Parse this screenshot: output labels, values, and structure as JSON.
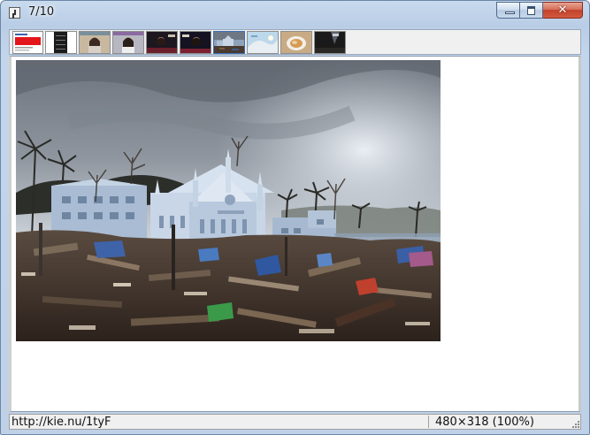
{
  "window": {
    "title": "7/10"
  },
  "title_controls": {
    "close_glyph": "✕"
  },
  "icons": {
    "app": "image-viewer-icon",
    "minimize": "minimize-icon",
    "maximize": "maximize-icon",
    "close": "close-icon",
    "resize": "resize-grip-icon"
  },
  "thumbnails": [
    {
      "name": "thumb-1",
      "active": false
    },
    {
      "name": "thumb-2",
      "active": false
    },
    {
      "name": "thumb-3",
      "active": false
    },
    {
      "name": "thumb-4",
      "active": false
    },
    {
      "name": "thumb-5",
      "active": false
    },
    {
      "name": "thumb-6",
      "active": false
    },
    {
      "name": "thumb-7",
      "active": true
    },
    {
      "name": "thumb-8",
      "active": false
    },
    {
      "name": "thumb-9",
      "active": false
    },
    {
      "name": "thumb-10",
      "active": false
    }
  ],
  "status": {
    "url": "http://kie.nu/1tyF",
    "image_info": "480×318 (100%)"
  },
  "colors": {
    "accent": "#3d6fb3",
    "close_button": "#c2412b",
    "frame": "#bfd1e7"
  }
}
